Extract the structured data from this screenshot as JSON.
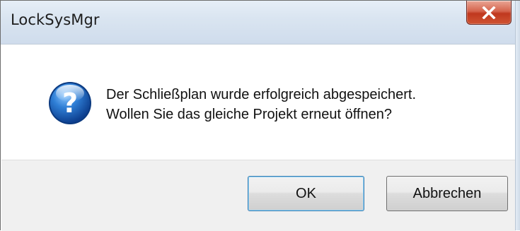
{
  "window": {
    "title": "LockSysMgr"
  },
  "titlebar": {
    "close_icon": "close-x-icon"
  },
  "dialog": {
    "icon": "question-icon",
    "icon_symbol": "?",
    "message_line1": "Der Schließplan wurde erfolgreich abgespeichert.",
    "message_line2": "Wollen Sie das gleiche Projekt erneut öffnen?"
  },
  "buttons": {
    "ok_label": "OK",
    "cancel_label": "Abbrechen"
  },
  "colors": {
    "titlebar": "#dae5f1",
    "close_button": "#c7452a",
    "icon_blue": "#1f63b8",
    "footer": "#f0f0f0",
    "default_button_border": "#3c7fb1"
  }
}
